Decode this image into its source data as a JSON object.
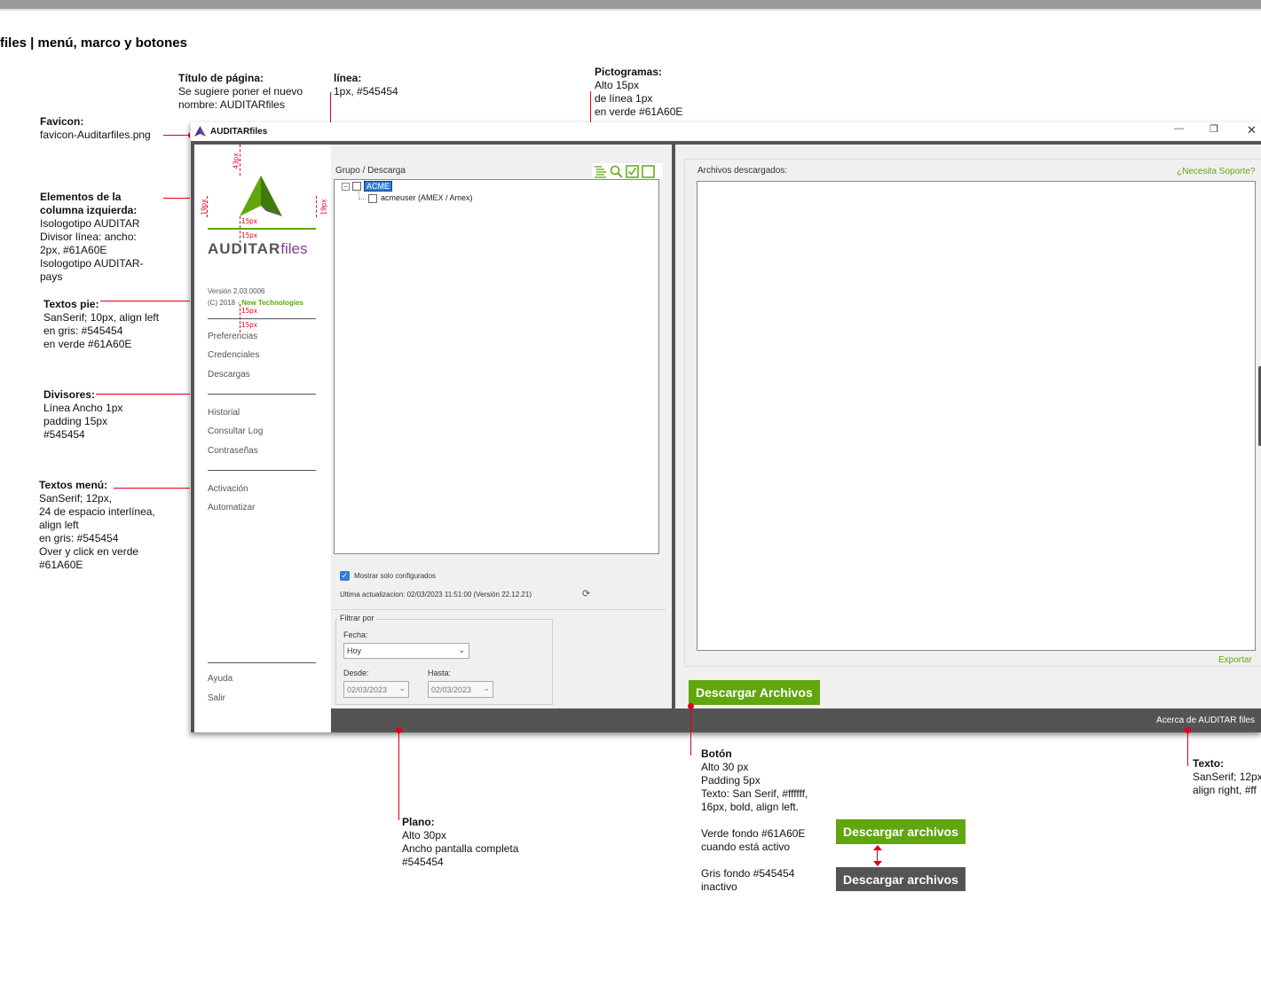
{
  "page": {
    "title": "files | menú, marco y botones"
  },
  "notes": {
    "page_title": {
      "heading": "Título de página:",
      "lines": [
        "Se sugiere poner el nuevo",
        "nombre: AUDITARfiles"
      ]
    },
    "line": {
      "heading": "línea:",
      "lines": [
        "1px, #545454"
      ]
    },
    "pictograms": {
      "heading": "Pictogramas:",
      "lines": [
        "Alto 15px",
        "de línea 1px",
        "en verde #61A60E"
      ]
    },
    "favicon": {
      "heading": "Favicon:",
      "lines": [
        "favicon-Auditarfiles.png"
      ]
    },
    "left_column": {
      "heading_lines": [
        "Elementos de la",
        "columna izquierda:"
      ],
      "lines": [
        "Isologotipo AUDITAR",
        "Divisor línea: ancho:",
        "2px, #61A60E",
        "Isologotipo AUDITAR-",
        "pays"
      ]
    },
    "footer_texts": {
      "heading": "Textos pie:",
      "lines": [
        "SanSerif; 10px, align left",
        "en gris: #545454",
        "en verde #61A60E"
      ]
    },
    "dividers": {
      "heading": "Divisores:",
      "lines": [
        "Línea Ancho 1px",
        "padding 15px",
        "#545454"
      ]
    },
    "menu_texts": {
      "heading": "Textos menú:",
      "lines": [
        "SanSerif; 12px,",
        "24 de espacio interlínea,",
        "align left",
        "en gris: #545454",
        "Over y click en verde",
        "#61A60E"
      ]
    },
    "plane": {
      "heading": "Plano:",
      "lines": [
        "Alto 30px",
        "Ancho pantalla completa",
        "#545454"
      ]
    },
    "button": {
      "heading": "Botón",
      "lines": [
        "Alto 30 px",
        "Padding 5px",
        "Texto: San Serif, #ffffff,",
        "16px, bold, align left."
      ]
    },
    "button_active": {
      "lines": [
        "Verde fondo #61A60E",
        "cuando está activo"
      ]
    },
    "button_inactive": {
      "lines": [
        "Gris fondo #545454",
        "inactivo"
      ]
    },
    "text": {
      "heading": "Texto:",
      "lines": [
        "SanSerif; 12px",
        "align right, #ff"
      ]
    }
  },
  "measures": {
    "m43": "43px",
    "m19": "19px",
    "m15": "15px"
  },
  "app": {
    "title": "AUDITARfiles",
    "window_controls": {
      "minimize": "—",
      "maximize": "❐",
      "close": "✕"
    },
    "brand": {
      "part1": "AUDITAR",
      "part2": "files"
    },
    "version": "Versión 2.03.0006",
    "copyright": "(C) 2018 - ",
    "company": "New Technologies",
    "menu_group1": [
      "Preferencias",
      "Credenciales",
      "Descargas"
    ],
    "menu_group2": [
      "Historial",
      "Consultar Log",
      "Contraseñas"
    ],
    "menu_group3": [
      "Activación",
      "Automatizar"
    ],
    "menu_bottom": [
      "Ayuda",
      "Salir"
    ],
    "tree": {
      "label": "Grupo / Descarga",
      "root": "ACME",
      "child": "acmeuser (AMEX / Amex)"
    },
    "show_configured": "Mostrar solo configurados",
    "last_update": "Ultima actualizacion: 02/03/2023 11:51:00 (Versión 22.12.21)",
    "filter": {
      "legend": "Filtrar por",
      "fecha_label": "Fecha:",
      "fecha_value": "Hoy",
      "desde_label": "Desde:",
      "desde_value": "02/03/2023",
      "hasta_label": "Hasta:",
      "hasta_value": "02/03/2023"
    },
    "downloaded_label": "Archivos descargados:",
    "support_link": "¿Necesita Soporte?",
    "export_link": "Exportar",
    "download_button": "Descargar Archivos",
    "about": "Acerca de AUDITAR files"
  },
  "samples": {
    "active_button": "Descargar archivos",
    "inactive_button": "Descargar archivos"
  },
  "colors": {
    "green": "#61A60E",
    "gray": "#545454",
    "annotation_red": "#e2001a"
  },
  "icons": [
    "list-icon",
    "search-icon",
    "checked-box-icon",
    "empty-box-icon"
  ]
}
